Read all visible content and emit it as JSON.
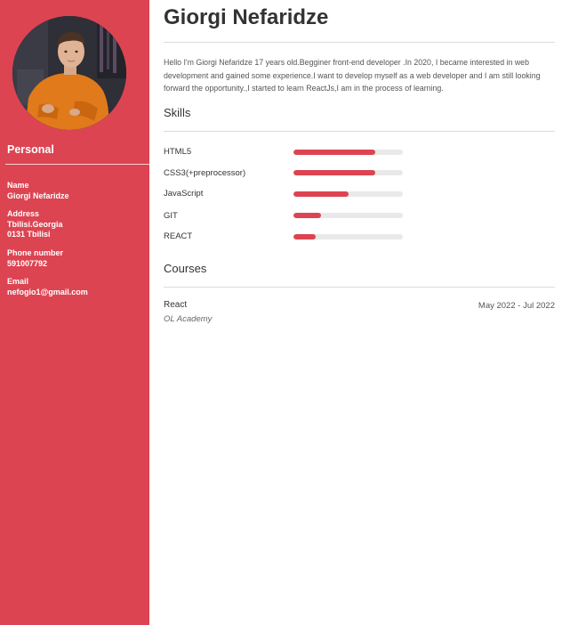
{
  "personal": {
    "heading": "Personal",
    "name_label": "Name",
    "name_value": "Giorgi Nefaridze",
    "address_label": "Address",
    "address_line1": "Tbilisi.Georgia",
    "address_line2": "0131 Tbilisi",
    "phone_label": "Phone number",
    "phone_value": "591007792",
    "email_label": "Email",
    "email_value": "nefogio1@gmail.com"
  },
  "header": {
    "name": "Giorgi Nefaridze"
  },
  "bio": "Hello I'm Giorgi Nefaridze 17 years old.Begginer front-end developer .In 2020, I became interested in web development and gained some experience.I want to develop myself as a web developer and I am still looking forward the opportunity.,I started to learn ReactJs,I am in the process of learning.",
  "skills": {
    "heading": "Skills",
    "items": [
      {
        "name": "HTML5",
        "level": 0.75
      },
      {
        "name": "CSS3(+preprocessor)",
        "level": 0.75
      },
      {
        "name": "JavaScript",
        "level": 0.5
      },
      {
        "name": "GIT",
        "level": 0.25
      },
      {
        "name": "REACT",
        "level": 0.2
      }
    ]
  },
  "courses": {
    "heading": "Courses",
    "items": [
      {
        "name": "React",
        "dates": "May 2022 - Jul 2022",
        "org": "OL Academy"
      }
    ]
  },
  "colors": {
    "accent": "#dc4452",
    "track": "#e9e9e9"
  }
}
